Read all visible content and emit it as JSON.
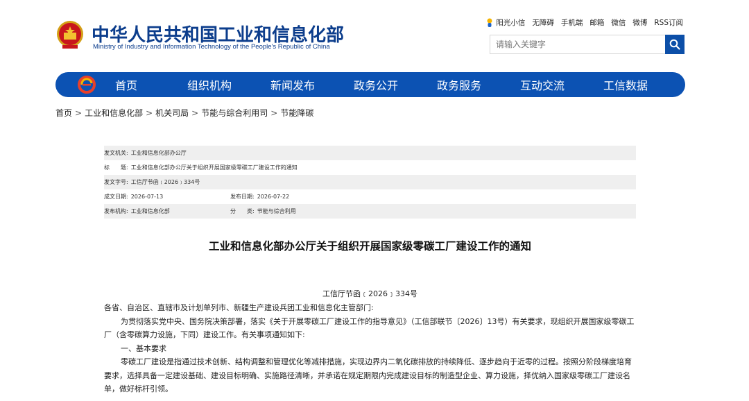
{
  "header": {
    "title_cn": "中华人民共和国工业和信息化部",
    "title_en": "Ministry of Industry and Information Technology of the People's Republic of China",
    "toplinks": [
      "阳光小信",
      "无障碍",
      "手机端",
      "邮箱",
      "微信",
      "微博",
      "RSS订阅"
    ],
    "search_placeholder": "请输入关键字"
  },
  "nav": {
    "items": [
      "首页",
      "组织机构",
      "新闻发布",
      "政务公开",
      "政务服务",
      "互动交流",
      "工信数据"
    ]
  },
  "breadcrumb": [
    "首页",
    "工业和信息化部",
    "机关司局",
    "节能与综合利用司",
    "节能降碳"
  ],
  "meta": {
    "issuer_label": "发文机关:",
    "issuer": "工业和信息化部办公厅",
    "title_label": "标　　题:",
    "title": "工业和信息化部办公厅关于组织开展国家级零碳工厂建设工作的通知",
    "docno_label": "发文字号:",
    "docno": "工信厅节函﹝2026﹞334号",
    "created_label": "成文日期:",
    "created": "2026-07-13",
    "published_label": "发布日期:",
    "published": "2026-07-22",
    "org_label": "发布机构:",
    "org": "工业和信息化部",
    "category_label": "分　　类:",
    "category": "节能与综合利用"
  },
  "document": {
    "title": "工业和信息化部办公厅关于组织开展国家级零碳工厂建设工作的通知",
    "number": "工信厅节函﹝2026﹞334号",
    "salutation": "各省、自治区、直辖市及计划单列市、新疆生产建设兵团工业和信息化主管部门:",
    "para1": "为贯彻落实党中央、国务院决策部署，落实《关于开展零碳工厂建设工作的指导意见》（工信部联节〔2026〕13号）有关要求，现组织开展国家级零碳工厂（含零碳算力设施，下同）建设工作。有关事项通知如下:",
    "section1": "一、基本要求",
    "para2": "零碳工厂建设是指通过技术创新、结构调整和管理优化等减排措施，实现边界内二氧化碳排放的持续降低、逐步趋向于近零的过程。按照分阶段梯度培育要求，选择具备一定建设基础、建设目标明确、实施路径清晰，并承诺在规定期限内完成建设目标的制造型企业、算力设施，择优纳入国家级零碳工厂建设名单，做好标杆引领。"
  },
  "colors": {
    "brand_blue": "#0c52b3",
    "title_blue": "#0c3d8c",
    "meta_shade": "#efefef"
  }
}
